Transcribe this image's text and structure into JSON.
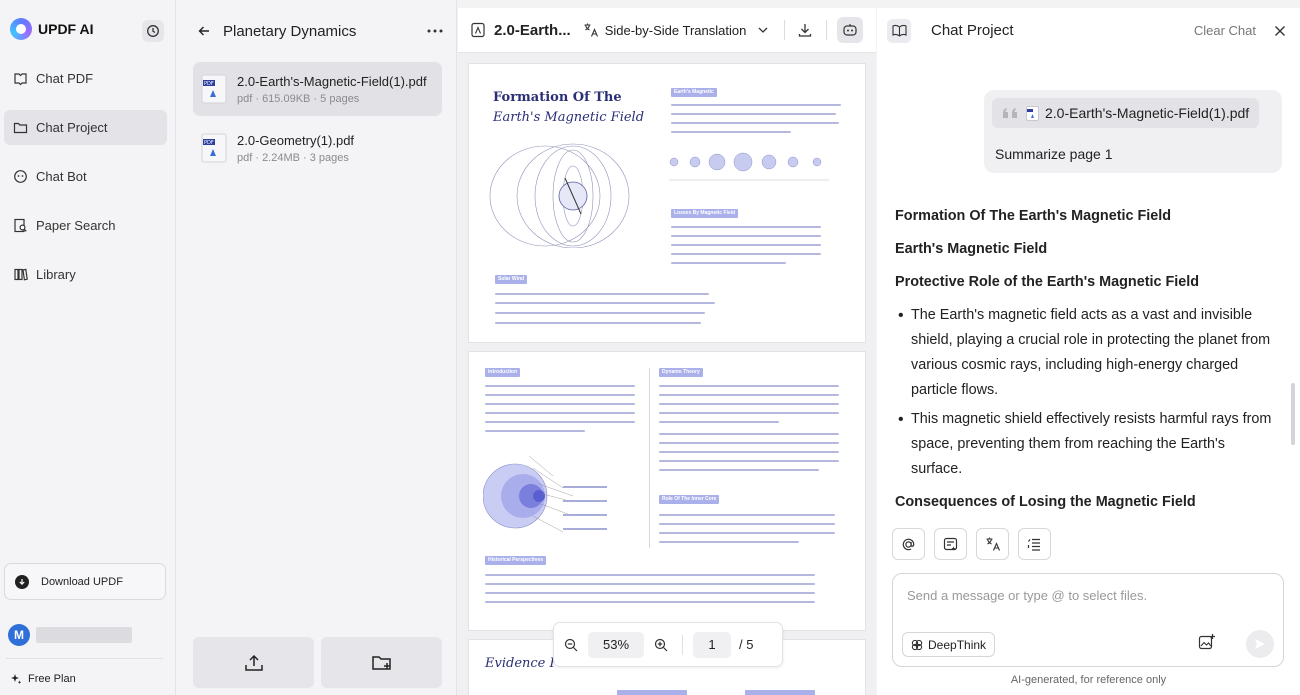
{
  "app": {
    "name": "UPDF AI"
  },
  "nav": {
    "items": [
      {
        "label": "Chat PDF",
        "icon": "chat-pdf-icon"
      },
      {
        "label": "Chat Project",
        "icon": "chat-project-icon",
        "active": true
      },
      {
        "label": "Chat Bot",
        "icon": "chat-bot-icon"
      },
      {
        "label": "Paper Search",
        "icon": "paper-search-icon"
      },
      {
        "label": "Library",
        "icon": "library-icon"
      }
    ],
    "download_label": "Download UPDF",
    "user_initial": "M",
    "plan_label": "Free Plan"
  },
  "project": {
    "title": "Planetary Dynamics",
    "files": [
      {
        "name": "2.0-Earth's-Magnetic-Field(1).pdf",
        "meta": "pdf · 615.09KB · 5 pages",
        "active": true
      },
      {
        "name": "2.0-Geometry(1).pdf",
        "meta": "pdf · 2.24MB · 3 pages",
        "active": false
      }
    ]
  },
  "viewer": {
    "doc_title": "2.0-Earth...",
    "translation_mode": "Side-by-Side Translation",
    "zoom": "53%",
    "current_page": "1",
    "total_pages": "/ 5",
    "page1": {
      "title_line1": "Formation Of The",
      "title_line2": "Earth's Magnetic Field",
      "tag_magnetic": "Earth's Magnetic",
      "tag_loss": "Losses By Magnetic Field",
      "tag_solar": "Solar Wind"
    },
    "page2": {
      "tag_intro": "Introduction",
      "tag_dynamo": "Dynamo Theory",
      "tag_inner": "Role Of The Inner Core",
      "tag_historical": "Historical Perspectives"
    },
    "page3": {
      "title": "Evidence Fo"
    },
    "colors": {
      "accent": "#2b2f76",
      "tag": "#aab0ea"
    }
  },
  "chat": {
    "title": "Chat Project",
    "clear_label": "Clear Chat",
    "user_message": {
      "file": "2.0-Earth's-Magnetic-Field(1).pdf",
      "text": "Summarize page 1"
    },
    "answer": {
      "h1": "Formation Of The Earth's Magnetic Field",
      "h2": "Earth's Magnetic Field",
      "h3": "Protective Role of the Earth's Magnetic Field",
      "bullets": [
        "The Earth's magnetic field acts as a vast and invisible shield, playing a crucial role in protecting the planet from various cosmic rays, including high-energy charged particle flows.",
        "This magnetic shield effectively resists harmful rays from space, preventing them from reaching the Earth's surface."
      ],
      "h4": "Consequences of Losing the Magnetic Field"
    },
    "input_placeholder": "Send a message or type @ to select files.",
    "input_value": "",
    "deepthink_label": "DeepThink",
    "disclaimer": "AI-generated, for reference only"
  }
}
